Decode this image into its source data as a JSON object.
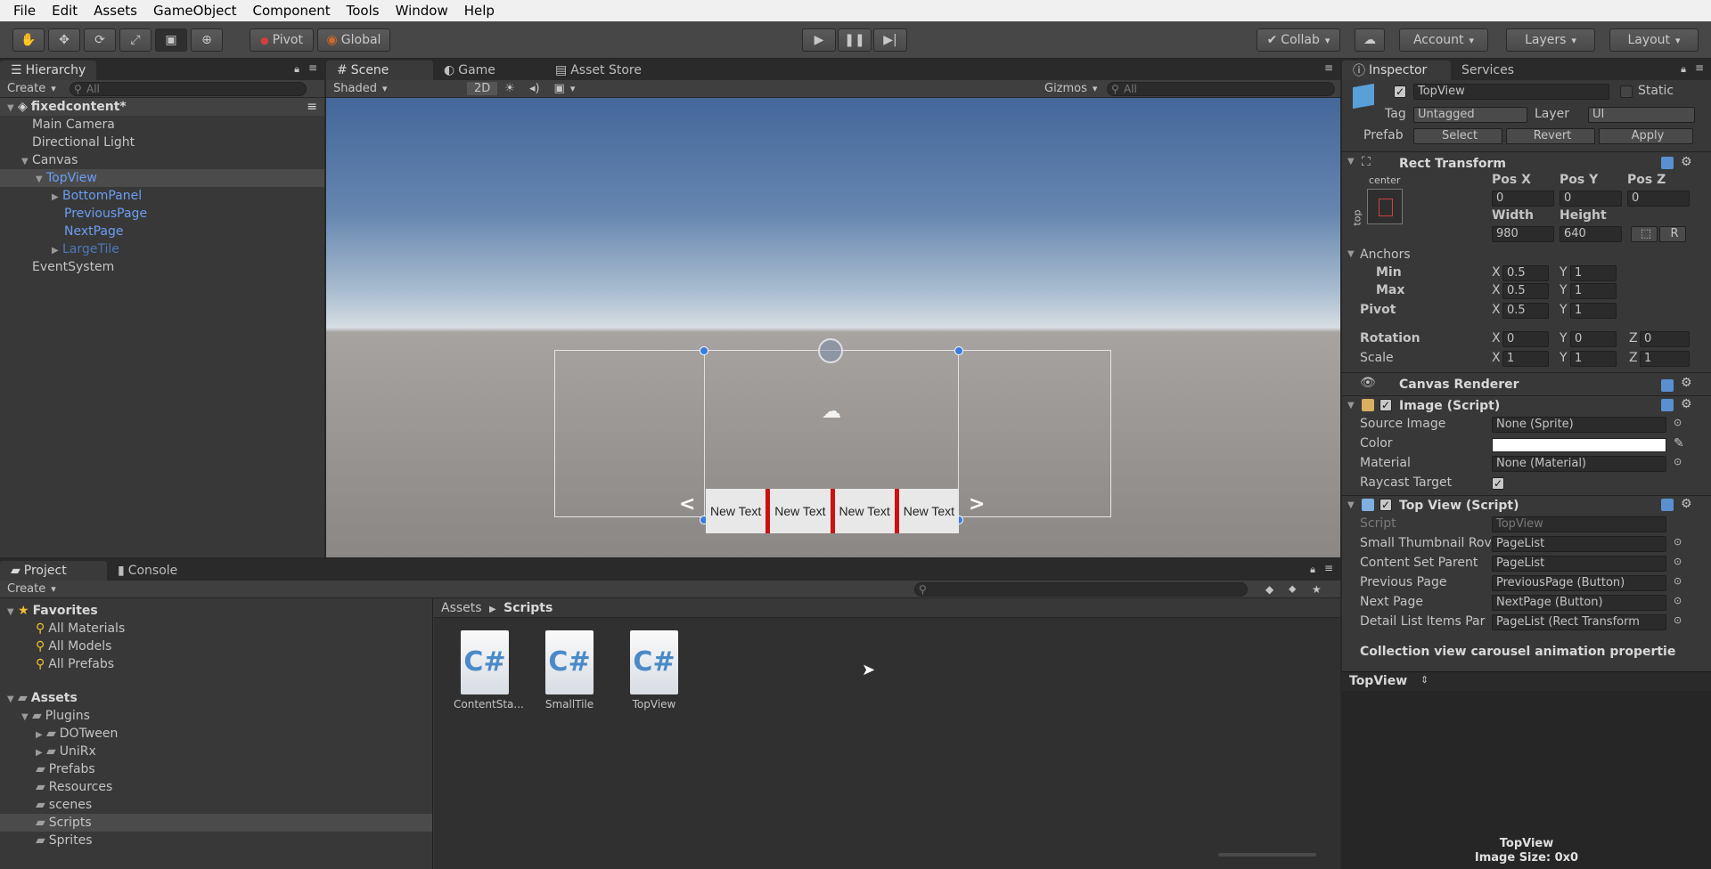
{
  "menu": [
    "File",
    "Edit",
    "Assets",
    "GameObject",
    "Component",
    "Tools",
    "Window",
    "Help"
  ],
  "toolbar": {
    "pivot": "Pivot",
    "global": "Global",
    "collab": "Collab",
    "account": "Account",
    "layers": "Layers",
    "layout": "Layout"
  },
  "hierarchy": {
    "tab": "Hierarchy",
    "create": "Create",
    "search_placeholder": "All",
    "scene": "fixedcontent*",
    "items": [
      "Main Camera",
      "Directional Light",
      "Canvas",
      "TopView",
      "BottomPanel",
      "PreviousPage",
      "NextPage",
      "LargeTile",
      "EventSystem"
    ]
  },
  "scene": {
    "tabs": [
      "Scene",
      "Game",
      "Asset Store"
    ],
    "shading": "Shaded",
    "mode_2d": "2D",
    "gizmos": "Gizmos",
    "search_placeholder": "All",
    "tiles": [
      "New Text",
      "New Text",
      "New Text",
      "New Text"
    ]
  },
  "project": {
    "tabs": [
      "Project",
      "Console"
    ],
    "create": "Create",
    "favorites": "Favorites",
    "fav_items": [
      "All Materials",
      "All Models",
      "All Prefabs"
    ],
    "assets": "Assets",
    "folders": [
      "Plugins",
      "DOTween",
      "UniRx",
      "Prefabs",
      "Resources",
      "scenes",
      "Scripts",
      "Sprites"
    ],
    "breadcrumb": [
      "Assets",
      "Scripts"
    ],
    "files": [
      "ContentSta...",
      "SmallTile",
      "TopView"
    ],
    "file_badge": "C#"
  },
  "inspector": {
    "tabs": [
      "Inspector",
      "Services"
    ],
    "name": "TopView",
    "static": "Static",
    "tag_label": "Tag",
    "tag": "Untagged",
    "layer_label": "Layer",
    "layer": "UI",
    "prefab_label": "Prefab",
    "prefab_buttons": [
      "Select",
      "Revert",
      "Apply"
    ],
    "rect": {
      "title": "Rect Transform",
      "center": "center",
      "top": "top",
      "posx_label": "Pos X",
      "posy_label": "Pos Y",
      "posz_label": "Pos Z",
      "posx": "0",
      "posy": "0",
      "posz": "0",
      "width_label": "Width",
      "height_label": "Height",
      "width": "980",
      "height": "640",
      "r_btn": "R",
      "anchors": "Anchors",
      "min": "Min",
      "max": "Max",
      "pivot": "Pivot",
      "min_x": "0.5",
      "min_y": "1",
      "max_x": "0.5",
      "max_y": "1",
      "pivot_x": "0.5",
      "pivot_y": "1",
      "rotation": "Rotation",
      "scale": "Scale",
      "rot_x": "0",
      "rot_y": "0",
      "rot_z": "0",
      "scale_x": "1",
      "scale_y": "1",
      "scale_z": "1",
      "x": "X",
      "y": "Y",
      "z": "Z"
    },
    "canvas_renderer": "Canvas Renderer",
    "image": {
      "title": "Image (Script)",
      "source_label": "Source Image",
      "source": "None (Sprite)",
      "color_label": "Color",
      "material_label": "Material",
      "material": "None (Material)",
      "raycast_label": "Raycast Target"
    },
    "topview": {
      "title": "Top View (Script)",
      "script_label": "Script",
      "script": "TopView",
      "small_label": "Small Thumbnail Rov",
      "small": "PageList",
      "content_label": "Content Set Parent",
      "content": "PageList",
      "prev_label": "Previous Page",
      "prev": "PreviousPage (Button)",
      "next_label": "Next Page",
      "next": "NextPage (Button)",
      "detail_label": "Detail List Items Par",
      "detail": "PageList (Rect Transform"
    },
    "collection": "Collection view carousel animation propertie",
    "footer": "TopView",
    "preview_name": "TopView",
    "preview_size": "Image Size: 0x0"
  },
  "colors": {
    "accent": "#3a72b0",
    "selection": "#4b4b4b",
    "tile_divider": "#cc1111"
  }
}
